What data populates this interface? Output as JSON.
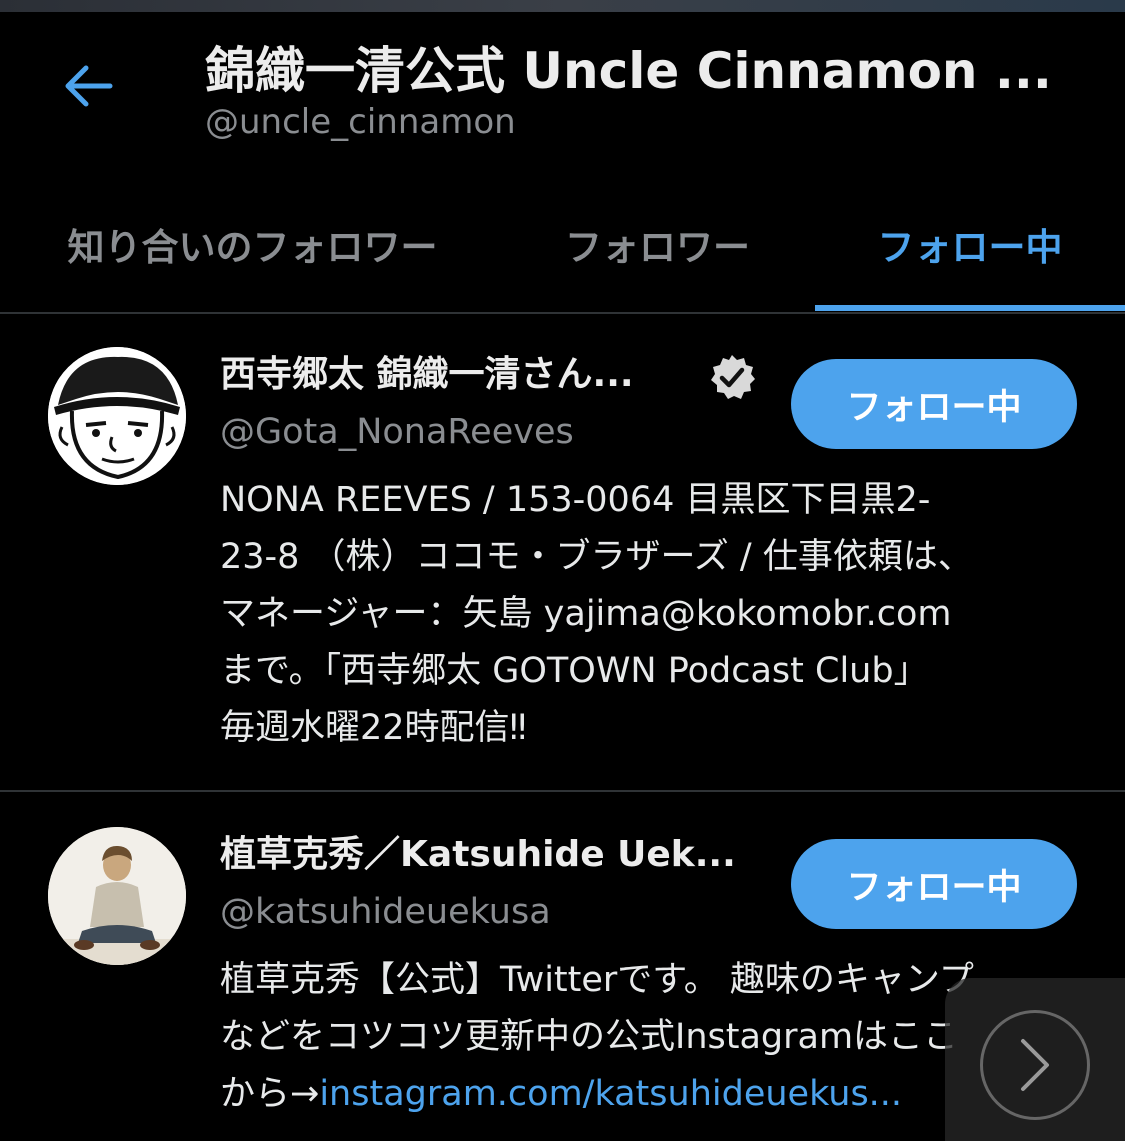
{
  "header": {
    "title": "錦織一清公式 Uncle Cinnamon ...",
    "handle": "@uncle_cinnamon",
    "back_icon": "back-arrow-icon"
  },
  "tabs": [
    {
      "label": "知り合いのフォロワー",
      "active": false
    },
    {
      "label": "フォロワー",
      "active": false
    },
    {
      "label": "フォロー中",
      "active": true
    }
  ],
  "colors": {
    "accent": "#4da3ed",
    "background": "#000000",
    "muted": "#8a8d91"
  },
  "users": [
    {
      "name": "西寺郷太 錦織一清さん...",
      "handle": "@Gota_NonaReeves",
      "verified": true,
      "follow_label": "フォロー中",
      "bio": "NONA REEVES / 153-0064 目黒区下目黒2-\n23-8 （株）ココモ・ブラザーズ / 仕事依頼は、\nマネージャー：矢島 yajima@kokomobr.com\nまで。「西寺郷太 GOTOWN Podcast Club」\n毎週水曜22時配信‼"
    },
    {
      "name": "植草克秀／Katsuhide Uek...",
      "handle": "@katsuhideuekusa",
      "verified": false,
      "follow_label": "フォロー中",
      "bio": "植草克秀【公式】Twitterです。 趣味のキャンプ\nなどをコツコツ更新中の公式Instagramはここ\nから→",
      "bio_link": "instagram.com/katsuhideuekus..."
    }
  ]
}
